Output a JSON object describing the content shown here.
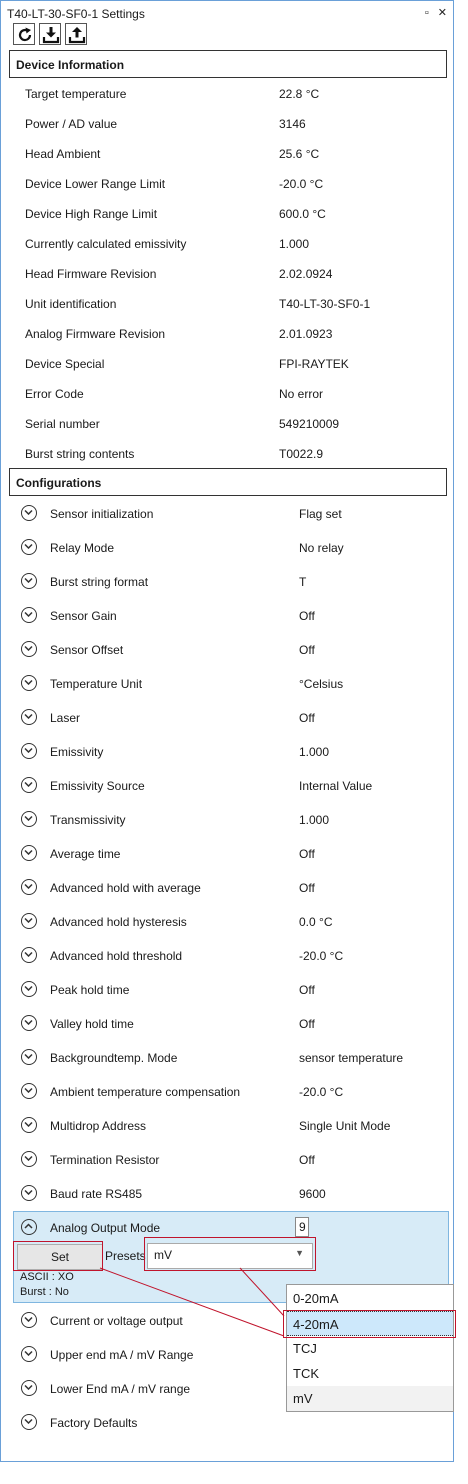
{
  "window": {
    "title": "T40-LT-30-SF0-1 Settings",
    "restore_glyph": "▫",
    "close_glyph": "✕"
  },
  "toolbar": {
    "buttons": [
      {
        "icon": "refresh-icon"
      },
      {
        "icon": "download-icon"
      },
      {
        "icon": "upload-icon"
      }
    ]
  },
  "device_information": {
    "header": "Device Information",
    "rows": [
      {
        "label": "Target temperature",
        "value": "22.8   °C"
      },
      {
        "label": "Power / AD value",
        "value": "3146"
      },
      {
        "label": "Head Ambient",
        "value": "25.6   °C"
      },
      {
        "label": "Device Lower Range Limit",
        "value": "-20.0   °C"
      },
      {
        "label": "Device High Range Limit",
        "value": "600.0   °C"
      },
      {
        "label": "Currently calculated emissivity",
        "value": "1.000"
      },
      {
        "label": "Head Firmware Revision",
        "value": "2.02.0924"
      },
      {
        "label": "Unit identification",
        "value": "T40-LT-30-SF0-1"
      },
      {
        "label": "Analog Firmware Revision",
        "value": "2.01.0923"
      },
      {
        "label": "Device Special",
        "value": "FPI-RAYTEK"
      },
      {
        "label": "Error Code",
        "value": "No error"
      },
      {
        "label": "Serial number",
        "value": "549210009"
      },
      {
        "label": "Burst string contents",
        "value": "T0022.9"
      }
    ]
  },
  "configurations": {
    "header": "Configurations",
    "rows_before": [
      {
        "label": "Sensor initialization",
        "value": "Flag set"
      },
      {
        "label": "Relay Mode",
        "value": "No relay"
      },
      {
        "label": "Burst string format",
        "value": "T"
      },
      {
        "label": "Sensor Gain",
        "value": "Off"
      },
      {
        "label": "Sensor Offset",
        "value": "Off"
      },
      {
        "label": "Temperature Unit",
        "value": "°Celsius"
      },
      {
        "label": "Laser",
        "value": "Off"
      },
      {
        "label": "Emissivity",
        "value": "1.000"
      },
      {
        "label": "Emissivity Source",
        "value": "Internal Value"
      },
      {
        "label": "Transmissivity",
        "value": "1.000"
      },
      {
        "label": "Average time",
        "value": "Off"
      },
      {
        "label": "Advanced hold with average",
        "value": "Off"
      },
      {
        "label": "Advanced hold hysteresis",
        "value": "0.0   °C"
      },
      {
        "label": "Advanced hold threshold",
        "value": "-20.0   °C"
      },
      {
        "label": "Peak hold time",
        "value": "Off"
      },
      {
        "label": "Valley hold time",
        "value": "Off"
      },
      {
        "label": "Backgroundtemp. Mode",
        "value": "sensor temperature"
      },
      {
        "label": "Ambient temperature compensation",
        "value": "-20.0   °C"
      },
      {
        "label": "Multidrop Address",
        "value": "Single Unit Mode"
      },
      {
        "label": "Termination Resistor",
        "value": "Off"
      },
      {
        "label": "Baud rate RS485",
        "value": "9600"
      }
    ],
    "expanded": {
      "label": "Analog Output Mode",
      "number_value": "9",
      "set_label": "Set",
      "presets_label": "Presets",
      "selected_preset": "mV",
      "ascii_status": "ASCII : XO",
      "burst_status": "Burst : No",
      "dropdown_options": [
        "0-20mA",
        "4-20mA",
        "TCJ",
        "TCK",
        "mV"
      ],
      "highlighted_option": "4-20mA"
    },
    "rows_after": [
      {
        "label": "Current or voltage output"
      },
      {
        "label": "Upper end mA / mV Range"
      },
      {
        "label": "Lower End mA / mV range"
      },
      {
        "label": "Factory Defaults"
      }
    ]
  },
  "colors": {
    "expanded_bg": "#d7ebf7",
    "annotation_red": "#c0142c",
    "selected_option_bg": "#cde8fb"
  }
}
